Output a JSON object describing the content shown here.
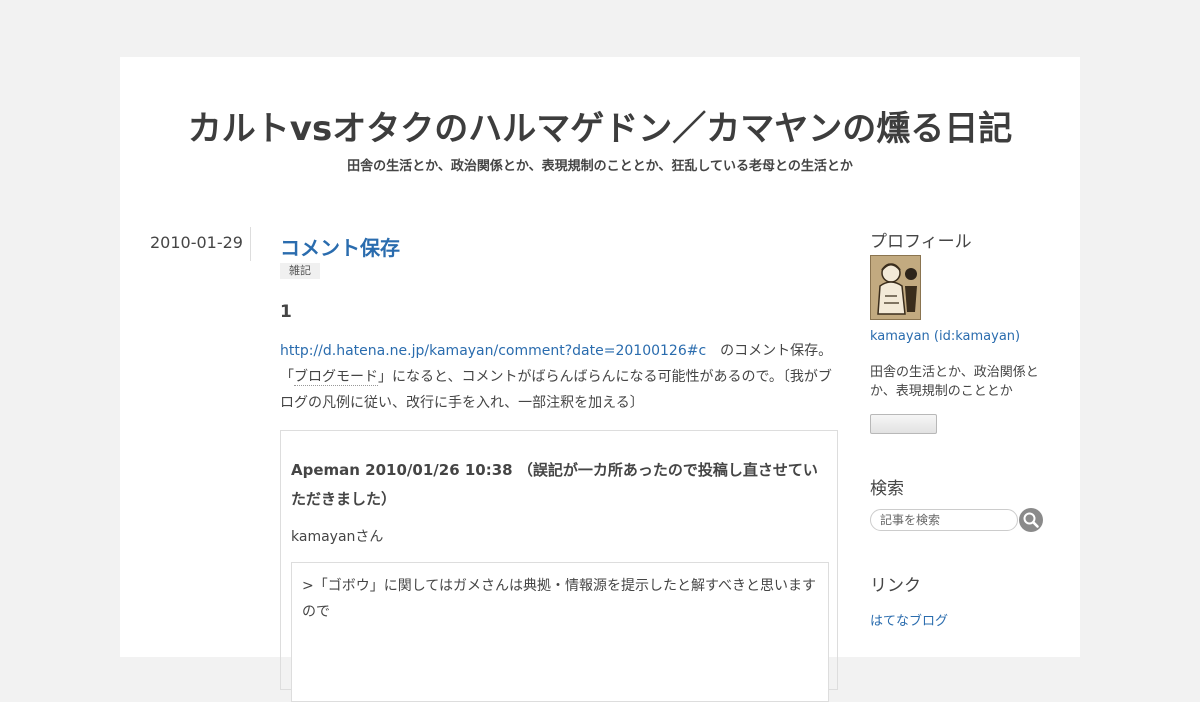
{
  "header": {
    "title": "カルトvsオタクのハルマゲドン／カマヤンの燻る日記",
    "description": "田舎の生活とか、政治関係とか、表現規制のこととか、狂乱している老母との生活とか"
  },
  "entry": {
    "date": "2010-01-29",
    "title": "コメント保存",
    "category": "雑記",
    "section_heading": "1",
    "paragraph": {
      "link": "http://d.hatena.ne.jp/kamayan/comment?date=20100126#c",
      "text1": "　のコメント保存。「",
      "keyword1": "ブログモード",
      "text2": "」になると、コメントがばらんばらんになる可能性があるので。〔我がブログの凡例に従い、改行に手を入れ、一部注釈を加える〕"
    },
    "comment": {
      "header": "Apeman 2010/01/26 10:38 （誤記が一カ所あったので投稿し直させていただきました）",
      "salutation": "kamayanさん",
      "quote": ">「ゴボウ」に関してはガメさんは典拠・情報源を提示したと解すべきと思いますので"
    }
  },
  "sidebar": {
    "profile": {
      "heading": "プロフィール",
      "icon": "user-avatar-icon",
      "name": "kamayan (id:kamayan)",
      "description": "田舎の生活とか、政治関係とか、表現規制のこととか"
    },
    "search": {
      "heading": "検索",
      "placeholder": "記事を検索",
      "icon": "search-icon"
    },
    "links": {
      "heading": "リンク",
      "items": [
        "はてなブログ"
      ]
    }
  },
  "colors": {
    "link": "#2a6cae",
    "text": "#454545",
    "background": "#f2f2f2"
  }
}
